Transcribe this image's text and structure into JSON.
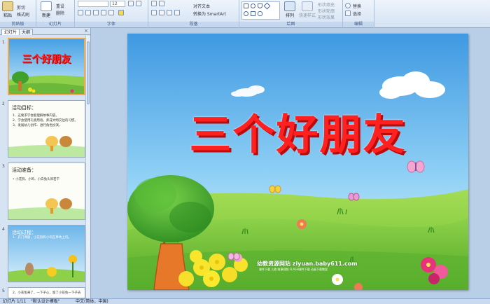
{
  "ribbon": {
    "groups": [
      {
        "label": "剪贴板"
      },
      {
        "label": "幻灯片"
      },
      {
        "label": "字体"
      },
      {
        "label": "段落"
      },
      {
        "label": "绘图"
      },
      {
        "label": "编辑"
      }
    ],
    "paste_label": "粘贴",
    "cut_label": "剪切",
    "format_painter_label": "格式刷",
    "new_slide_label": "新建",
    "new_slide_label2": "幻灯片",
    "reset_label": "重设",
    "delete_label": "删除",
    "font_size_value": "12",
    "align_text_label": "对齐文本",
    "smartart_label": "转换为 SmartArt",
    "arrange_label": "排列",
    "quick_styles_label": "快速样式",
    "shape_fill_label": "形状填充",
    "shape_outline_label": "形状轮廓",
    "shape_effects_label": "形状效果",
    "replace_label": "替换",
    "select_label": "选择"
  },
  "left_panel": {
    "tab_slides": "幻灯片",
    "tab_outline": "大纲",
    "close_glyph": "×",
    "slides": [
      {
        "num": "1",
        "title": "三个好朋友"
      },
      {
        "num": "2",
        "title": "活动目标：",
        "lines": [
          "1、这要求学会能理解故事内容。",
          "2、学会使用礼貌用语，养成文明交往的习惯。",
          "3、发展幼儿创作、进行角色扮演。"
        ]
      },
      {
        "num": "3",
        "title": "活动准备：",
        "lines": [
          "• 小花狗、小鸡、小白兔头饰若干"
        ]
      },
      {
        "num": "4",
        "title": "活动过程：",
        "lines": [
          "1、开门课题，小花狗和小鸡在草地上玩。"
        ]
      },
      {
        "num": "5",
        "lines": [
          "2、小花兔来了，一下子心，留了小花兔一下子去"
        ]
      }
    ]
  },
  "slide": {
    "title": "三个好朋友",
    "site_name": "幼教资源网站  ziyuan.baby611.com",
    "site_sub": "课件下载  儿歌  故事视频  FLASH课件下载  动画下载教案"
  },
  "status": {
    "slide_info": "幻灯片 1/11",
    "theme": "\"默认设计模板\"",
    "language": "中文(简体，中国)"
  },
  "colors": {
    "title_red": "#ff2020",
    "sky_top": "#4aa2e6",
    "grass": "#7cc83a"
  }
}
